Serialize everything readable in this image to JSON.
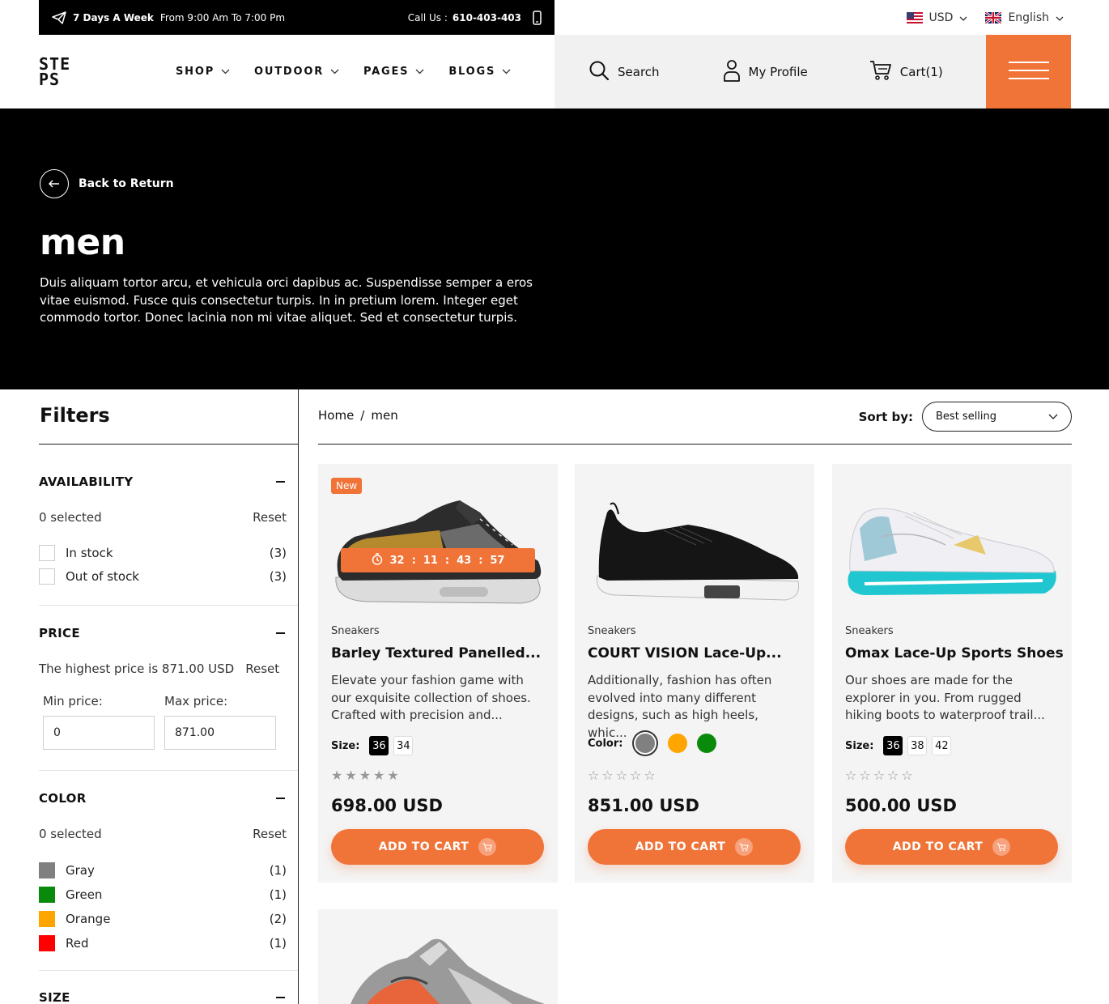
{
  "topbar": {
    "hours_bold": "7 Days A Week",
    "hours_text": "From 9:00 Am To 7:00 Pm",
    "call_label": "Call Us :",
    "call_number": "610-403-403"
  },
  "locale": {
    "currency": "USD",
    "language": "English"
  },
  "header": {
    "logo_line1": "STE",
    "logo_line2": "PS",
    "nav": [
      {
        "label": "SHOP"
      },
      {
        "label": "OUTDOOR"
      },
      {
        "label": "PAGES"
      },
      {
        "label": "BLOGS"
      }
    ],
    "search_label": "Search",
    "profile_label": "My Profile",
    "cart_label": "Cart(1)"
  },
  "hero": {
    "back_label": "Back to Return",
    "title": "men",
    "description": "Duis aliquam tortor arcu, et vehicula orci dapibus ac. Suspendisse semper a eros vitae euismod. Fusce quis consectetur turpis. In in pretium lorem. Integer eget commodo tortor. Donec lacinia non mi vitae aliquet. Sed et consectetur turpis."
  },
  "filters": {
    "title": "Filters",
    "availability": {
      "heading": "AVAILABILITY",
      "selected": "0 selected",
      "reset": "Reset",
      "options": [
        {
          "label": "In stock",
          "count": "(3)"
        },
        {
          "label": "Out of stock",
          "count": "(3)"
        }
      ]
    },
    "price": {
      "heading": "PRICE",
      "info": "The highest price is 871.00 USD",
      "reset": "Reset",
      "min_label": "Min price:",
      "max_label": "Max price:",
      "min_value": "0",
      "max_value": "871.00"
    },
    "color": {
      "heading": "COLOR",
      "selected": "0 selected",
      "reset": "Reset",
      "options": [
        {
          "label": "Gray",
          "count": "(1)",
          "hex": "#808080"
        },
        {
          "label": "Green",
          "count": "(1)",
          "hex": "#0a8a0a"
        },
        {
          "label": "Orange",
          "count": "(2)",
          "hex": "#ffa500"
        },
        {
          "label": "Red",
          "count": "(1)",
          "hex": "#ff0000"
        }
      ]
    },
    "size": {
      "heading": "SIZE"
    }
  },
  "breadcrumb": {
    "home": "Home",
    "sep": "/",
    "current": "men"
  },
  "sort": {
    "label": "Sort by:",
    "value": "Best selling"
  },
  "products": [
    {
      "badge": "New",
      "timer": [
        "32",
        ":",
        "11",
        ":",
        "43",
        ":",
        "57"
      ],
      "category": "Sneakers",
      "name": "Barley Textured Panelled...",
      "description": "Elevate your fashion game with our exquisite collection of shoes. Crafted with precision and...",
      "option_label": "Size:",
      "sizes": [
        "36",
        "34"
      ],
      "rating": 5,
      "price": "698.00 USD",
      "button": "ADD TO CART"
    },
    {
      "category": "Sneakers",
      "name": "COURT VISION Lace-Up...",
      "description": "Additionally, fashion has often evolved into many different designs, such as high heels, whic...",
      "option_label": "Color:",
      "colors": [
        "#808080",
        "#ffa500",
        "#0a8a0a"
      ],
      "rating": 0,
      "price": "851.00 USD",
      "button": "ADD TO CART"
    },
    {
      "category": "Sneakers",
      "name": "Omax Lace-Up Sports Shoes",
      "description": "Our shoes are made for the explorer in you. From rugged hiking boots to waterproof trail...",
      "option_label": "Size:",
      "sizes": [
        "36",
        "38",
        "42"
      ],
      "rating": 0,
      "price": "500.00 USD",
      "button": "ADD TO CART"
    }
  ],
  "colors": {
    "accent": "#f07338",
    "dark": "#000000",
    "panel": "#f4f4f4"
  }
}
